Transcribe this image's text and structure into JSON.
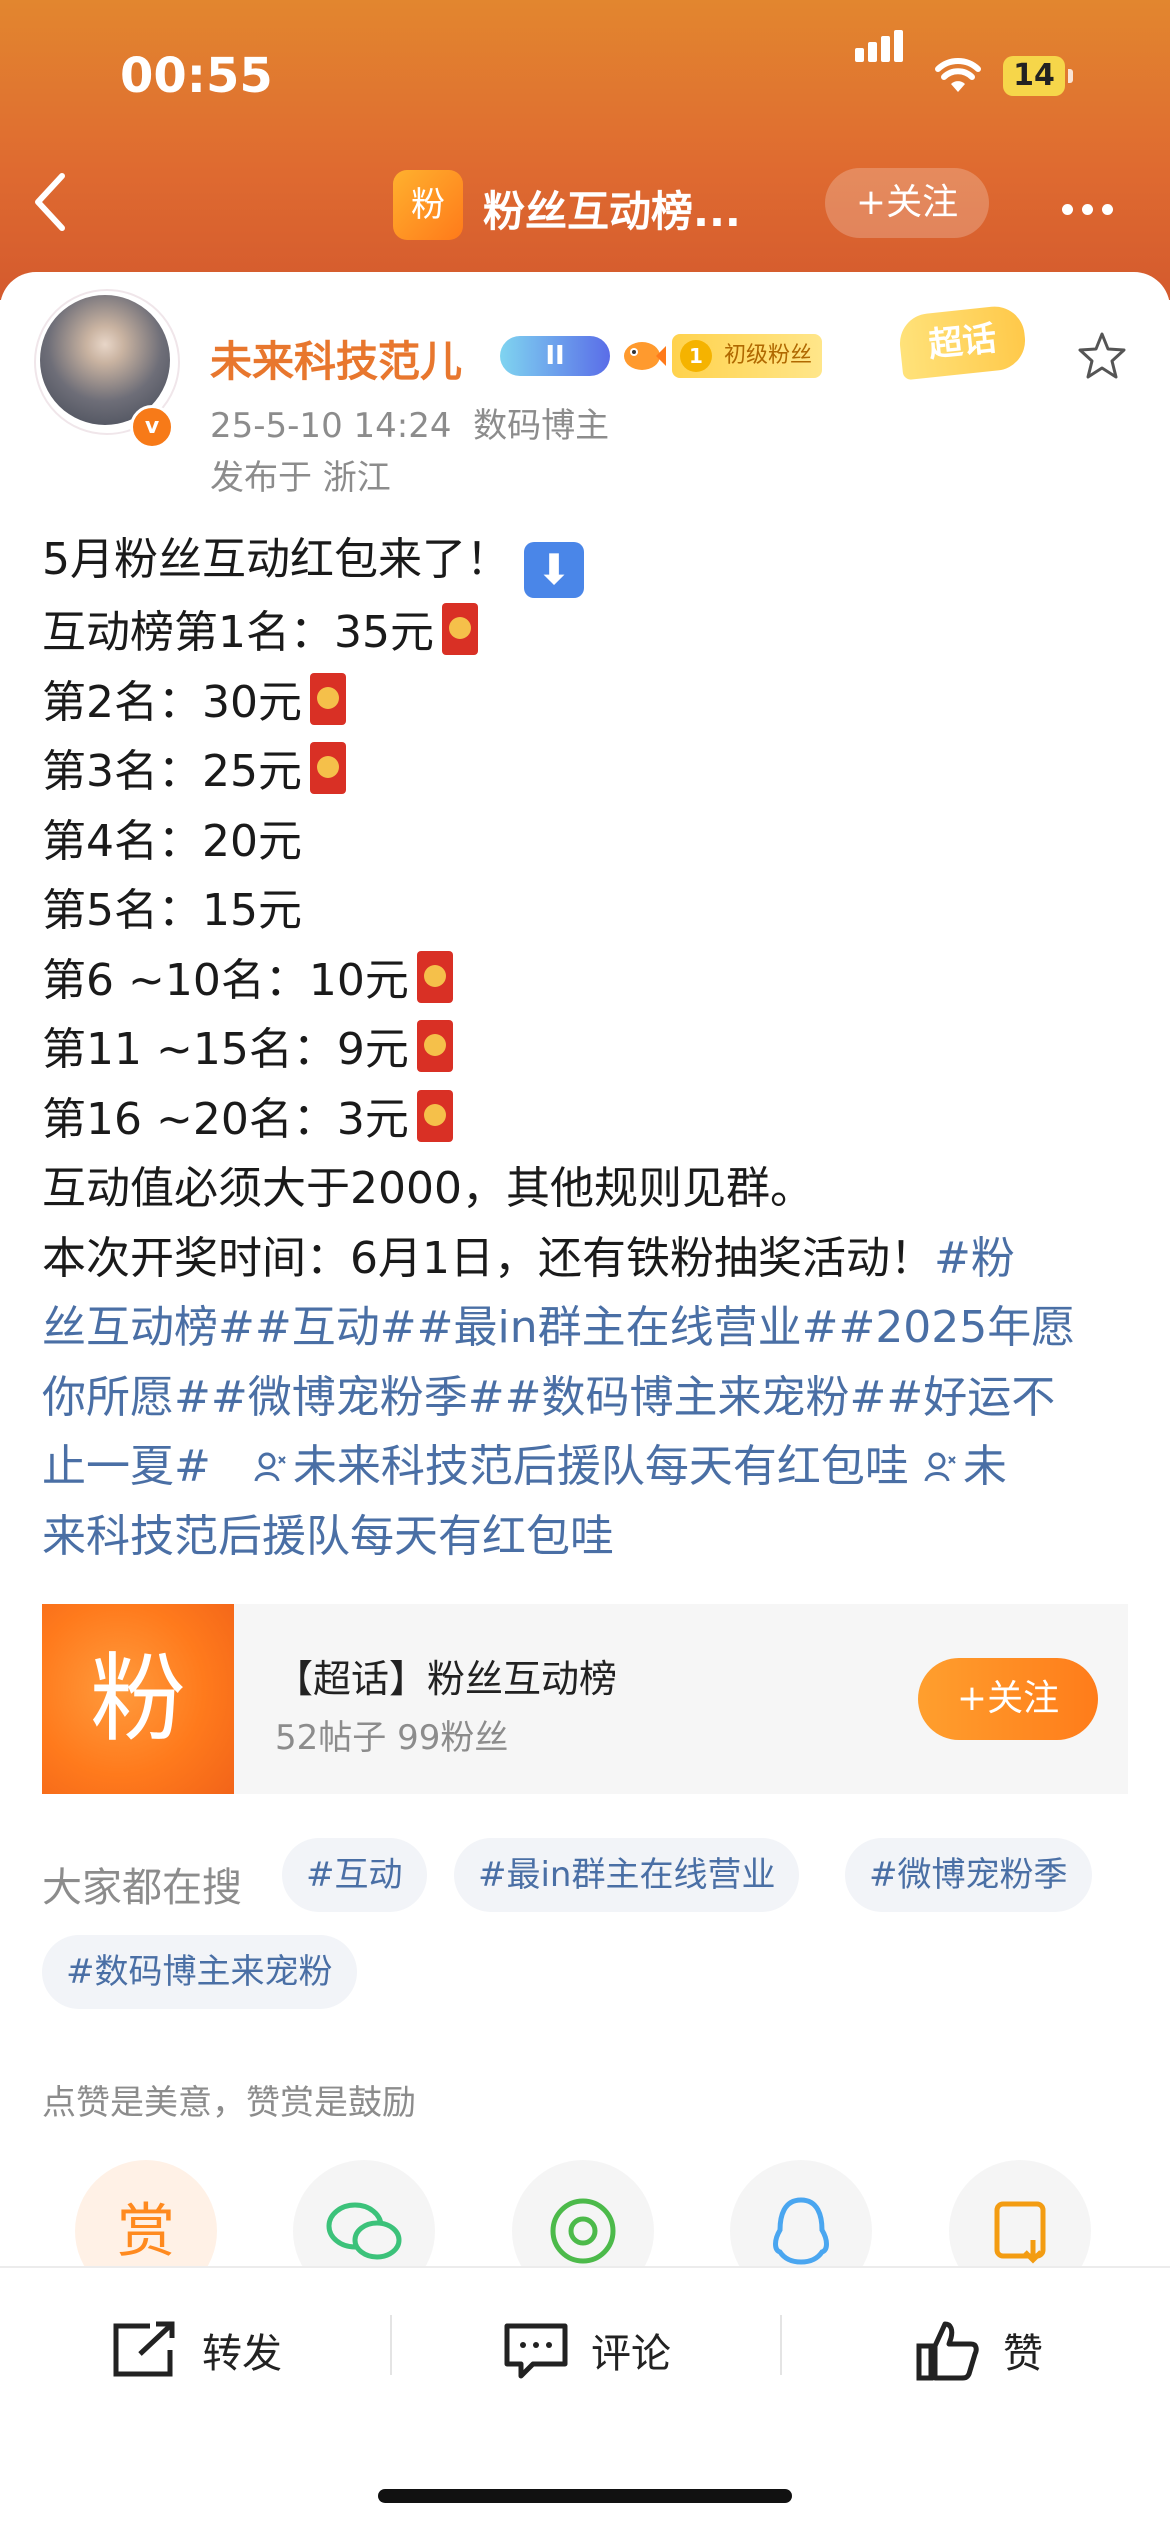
{
  "status_bar": {
    "time": "00:55",
    "battery": "14"
  },
  "header": {
    "badge": "粉",
    "title": "粉丝互动榜...",
    "follow": "+关注"
  },
  "author": {
    "name": "未来科技范儿",
    "level_badge": "II",
    "fan_badge": "初级粉丝",
    "fan_badge_num": "1",
    "chaohua_badge": "超话",
    "datetime": "25-5-10 14:24",
    "role": "数码博主",
    "location": "发布于 浙江"
  },
  "post": {
    "lines": [
      "5月粉丝互动红包来了！",
      "互动榜第1名：35元",
      "第2名：30元",
      "第3名：25元",
      "第4名：20元",
      "第5名：15元",
      "第6 ~10名：10元",
      "第11 ~15名：9元",
      "第16 ~20名：3元",
      "互动值必须大于2000，其他规则见群。",
      "本次开奖时间：6月1日，还有铁粉抽奖活动！"
    ],
    "tag_line1": "#粉",
    "tag_line2": "丝互动榜##互动##最in群主在线营业##2025年愿",
    "tag_line3": "你所愿##微博宠粉季##数码博主来宠粉##好运不",
    "tag_line4": "止一夏#",
    "mention1": "未来科技范后援队每天有红包哇",
    "mention2a": "未",
    "mention2b": "来科技范后援队每天有红包哇"
  },
  "topic_card": {
    "badge": "粉",
    "name": "【超话】粉丝互动榜",
    "stats": "52帖子 99粉丝",
    "follow": "+关注"
  },
  "search": {
    "label": "大家都在搜",
    "chips": [
      "#互动",
      "#最in群主在线营业",
      "#微博宠粉季",
      "#数码博主来宠粉"
    ]
  },
  "praise_hint": "点赞是美意，赞赏是鼓励",
  "share": {
    "reward": "赏"
  },
  "actions": {
    "repost": "转发",
    "comment": "评论",
    "like": "赞"
  }
}
